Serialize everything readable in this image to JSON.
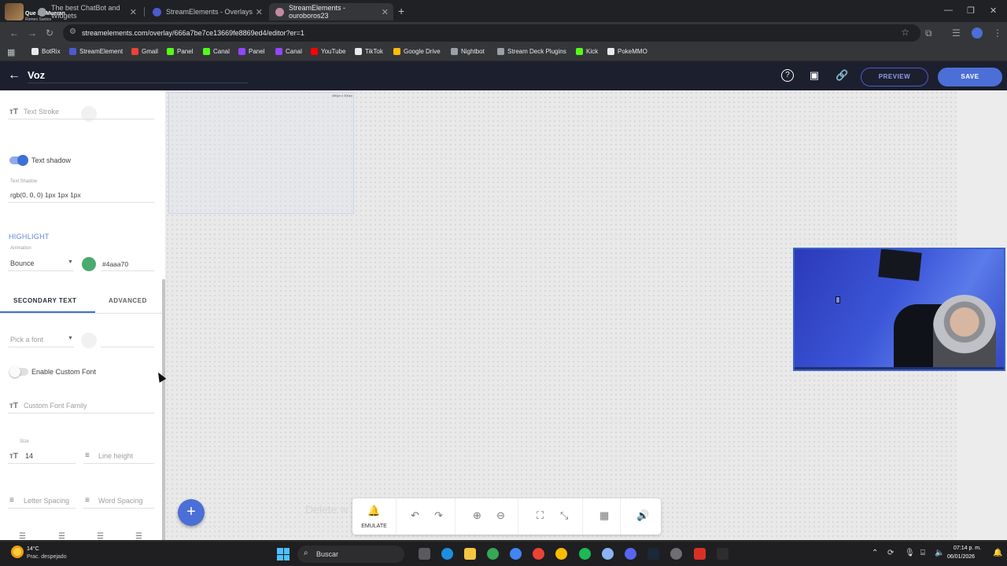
{
  "browser": {
    "profile": {
      "name": "Que Se Mueran",
      "sub": "Romeo Santos"
    },
    "tabs": [
      {
        "label": "The best ChatBot and Widgets",
        "favicon_color": "#9aa0a6"
      },
      {
        "label": "StreamElements - Overlays",
        "favicon_color": "#4b5bd0"
      },
      {
        "label": "StreamElements - ouroboros23",
        "favicon_color": "#c58aa0"
      }
    ],
    "url": "streamelements.com/overlay/666a7be7ce13669fe8869ed4/editor?er=1",
    "bookmarks": [
      {
        "label": "BotRix",
        "color": "#e8eaed"
      },
      {
        "label": "StreamElement",
        "color": "#4b5bd0"
      },
      {
        "label": "Gmail",
        "color": "#ea4335"
      },
      {
        "label": "Panel",
        "color": "#53fc18"
      },
      {
        "label": "Canal",
        "color": "#53fc18"
      },
      {
        "label": "Panel",
        "color": "#9146ff"
      },
      {
        "label": "Canal",
        "color": "#9146ff"
      },
      {
        "label": "YouTube",
        "color": "#ff0000"
      },
      {
        "label": "TikTok",
        "color": "#e8eaed"
      },
      {
        "label": "Google Drive",
        "color": "#fbbc04"
      },
      {
        "label": "Nightbot",
        "color": "#9aa0a6"
      },
      {
        "label": "Stream Deck Plugins",
        "color": "#9aa0a6"
      },
      {
        "label": "Kick",
        "color": "#53fc18"
      },
      {
        "label": "PokeMMO",
        "color": "#e8eaed"
      }
    ]
  },
  "header": {
    "overlay_name": "Voz",
    "preview_label": "PREVIEW",
    "save_label": "SAVE"
  },
  "panel": {
    "text_stroke_label": "Text Stroke",
    "text_shadow_toggle_label": "Text shadow",
    "text_shadow_field_label": "Text Shadow",
    "text_shadow_value": "rgb(0, 0, 0) 1px 1px 1px",
    "highlight_title": "HIGHLIGHT",
    "animation_label": "Animation",
    "animation_value": "Bounce",
    "highlight_color_value": "#4aaa70",
    "tabs": {
      "secondary": "SECONDARY TEXT",
      "advanced": "ADVANCED"
    },
    "font_picker_placeholder": "Pick a font",
    "custom_font_toggle_label": "Enable Custom Font",
    "custom_font_family_placeholder": "Custom Font Family",
    "size_label": "Size",
    "size_value": "14",
    "line_height_placeholder": "Line height",
    "letter_spacing_placeholder": "Letter Spacing",
    "word_spacing_placeholder": "Word Spacing"
  },
  "canvas": {
    "widget_size": "450px x 300px",
    "delete_hint": "Delete w",
    "emulate_label": "EMULATE"
  },
  "taskbar": {
    "temperature": "14°C",
    "weather": "Prac. despejado",
    "search_label": "Buscar",
    "time": "07:14 p. m.",
    "date": "06/01/2026"
  }
}
